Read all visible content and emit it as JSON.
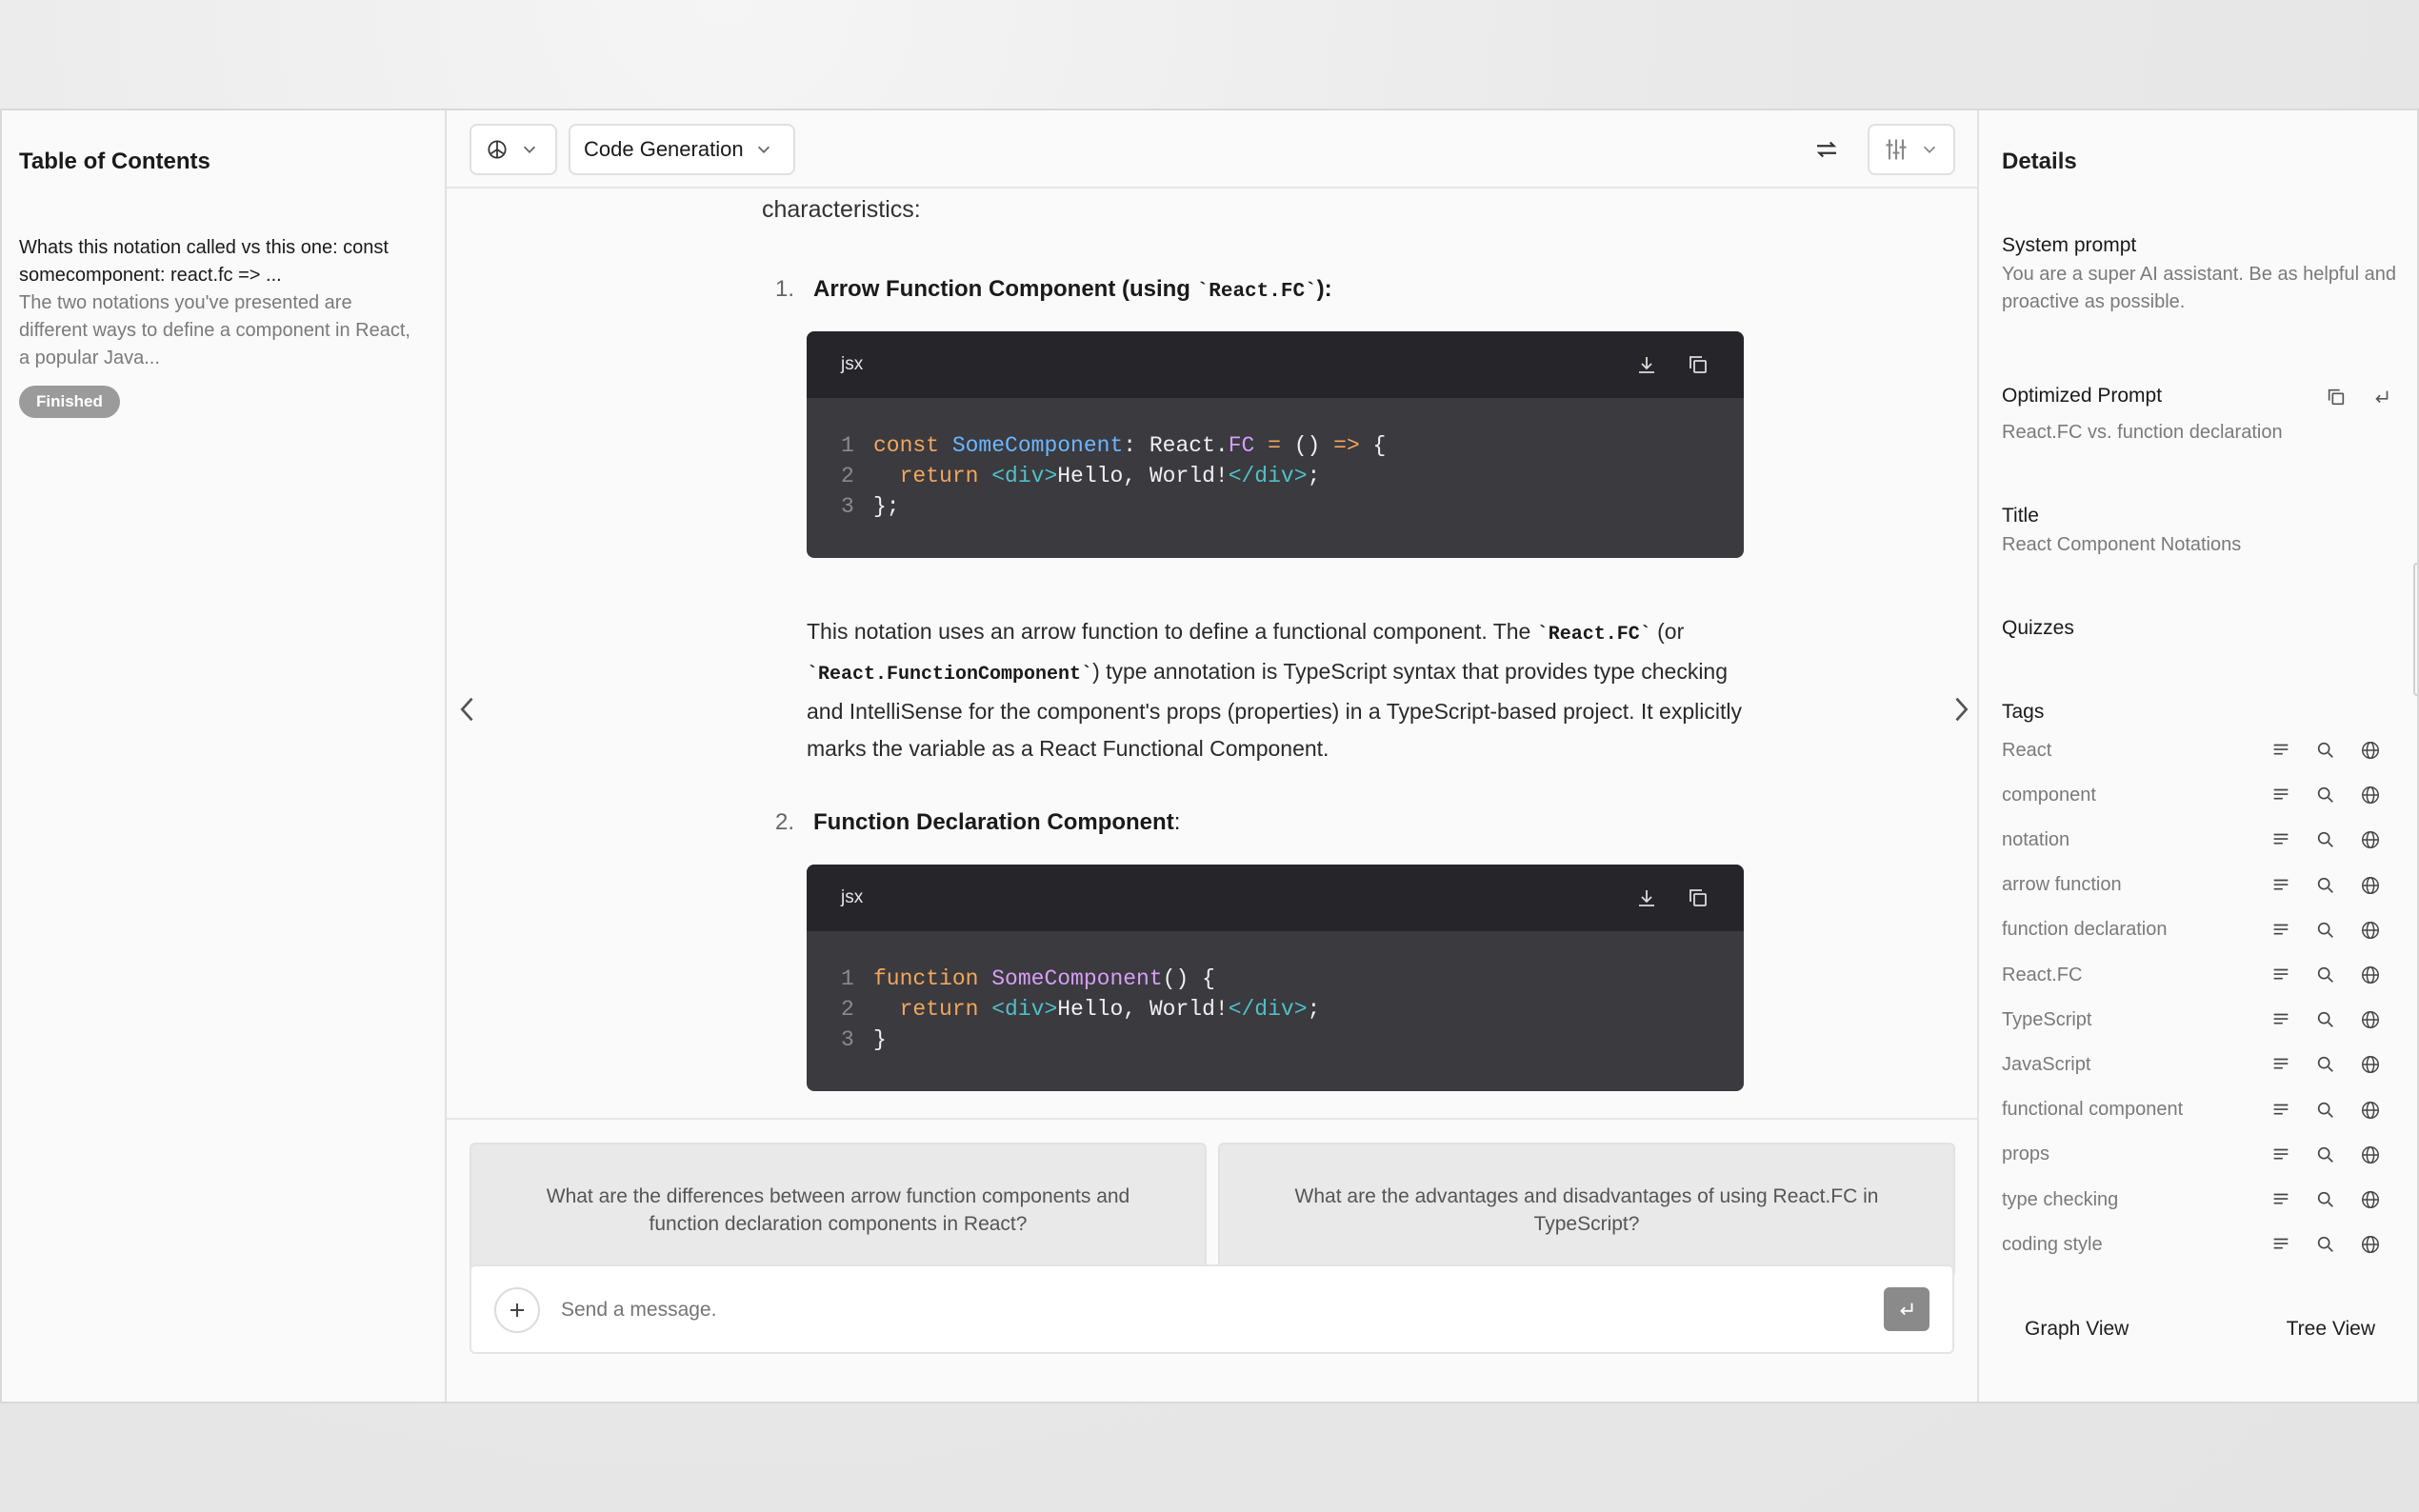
{
  "left": {
    "title": "Table of Contents",
    "item": {
      "question": "Whats this notation called vs this one: const somecomponent: react.fc => ...",
      "answer": "The two notations you've presented are different ways to define a component in React, a popular Java...",
      "status": "Finished"
    }
  },
  "toolbar": {
    "model_icon": "openai-icon",
    "mode_label": "Code Generation"
  },
  "content": {
    "lead": "characteristics:",
    "item1": {
      "num": "1.",
      "title": "Arrow Function Component (using ",
      "code": "`React.FC`",
      "suffix": "):"
    },
    "code1": {
      "lang": "jsx",
      "lines": [
        "const SomeComponent: React.FC = () => {",
        "  return <div>Hello, World!</div>;",
        "};"
      ]
    },
    "para": {
      "t1": "This notation uses an arrow function to define a functional component. The ",
      "c1": "`React.FC`",
      "t2": " (or ",
      "c2": "`React.FunctionComponent`",
      "t3": ") type annotation is TypeScript syntax that provides type checking and IntelliSense for the component's props (properties) in a TypeScript-based project. It explicitly marks the variable as a React Functional Component."
    },
    "item2": {
      "num": "2.",
      "title": "Function Declaration Component",
      "suffix": ":"
    },
    "code2": {
      "lang": "jsx",
      "lines": [
        "function SomeComponent() {",
        "  return <div>Hello, World!</div>;",
        "}"
      ]
    }
  },
  "suggestions": [
    "What are the differences between arrow function components and function declaration components in React?",
    "What are the advantages and disadvantages of using React.FC in TypeScript?"
  ],
  "composer": {
    "placeholder": "Send a message."
  },
  "right": {
    "title": "Details",
    "system_prompt_label": "System prompt",
    "system_prompt": "You are a super AI assistant. Be as helpful and proactive as possible.",
    "optimized_label": "Optimized Prompt",
    "optimized": "React.FC vs. function declaration",
    "title_label": "Title",
    "title_value": "React Component Notations",
    "quizzes_label": "Quizzes",
    "tags_label": "Tags",
    "tags": [
      "React",
      "component",
      "notation",
      "arrow function",
      "function declaration",
      "React.FC",
      "TypeScript",
      "JavaScript",
      "functional component",
      "props",
      "type checking",
      "coding style"
    ],
    "graph_view": "Graph View",
    "tree_view": "Tree View"
  },
  "colors": {
    "code_bg": "#3a3a3f",
    "code_head": "#26262a",
    "badge": "#9b9b9b",
    "send": "#8a8a8a"
  }
}
